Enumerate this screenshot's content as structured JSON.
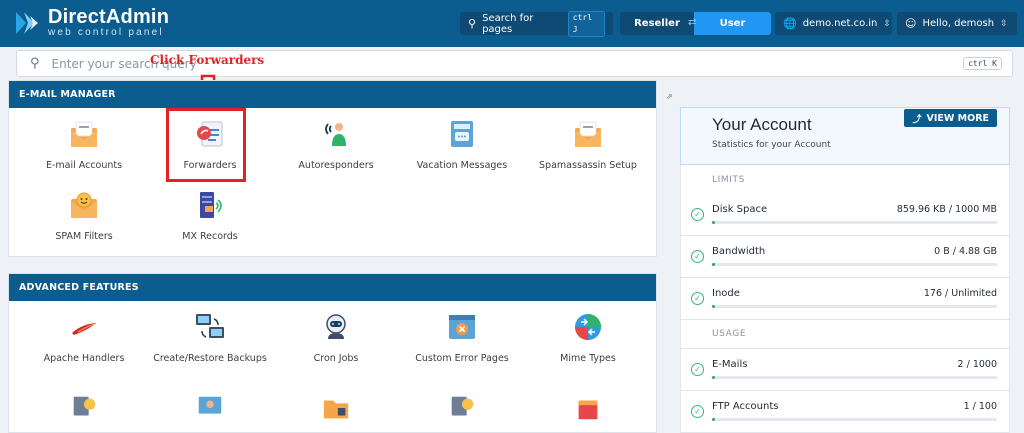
{
  "header": {
    "logo": {
      "title": "DirectAdmin",
      "subtitle": "web control panel"
    },
    "search_button": {
      "label": "Search for pages",
      "shortcut": "ctrl J",
      "icon": "search-icon"
    },
    "roles": {
      "reseller": "Reseller",
      "user": "User",
      "active": "User"
    },
    "domain": {
      "label": "demo.net.co.in",
      "icon": "globe-icon"
    },
    "account": {
      "label": "Hello, demosh",
      "icon": "user-icon"
    }
  },
  "search": {
    "placeholder": "Enter your search query",
    "shortcut": "ctrl K"
  },
  "annotation": {
    "text": "Click Forwarders",
    "color": "#e02424"
  },
  "email_manager": {
    "title": "E-MAIL MANAGER",
    "items": [
      {
        "label": "E-mail Accounts",
        "icon": "envelope-icon"
      },
      {
        "label": "Forwarders",
        "icon": "forwarders-icon"
      },
      {
        "label": "Autoresponders",
        "icon": "autoresponder-icon"
      },
      {
        "label": "Vacation Messages",
        "icon": "vacation-messages-icon"
      },
      {
        "label": "Spamassassin Setup",
        "icon": "spamassassin-icon"
      },
      {
        "label": "SPAM Filters",
        "icon": "spam-filters-icon"
      },
      {
        "label": "MX Records",
        "icon": "mx-records-icon"
      }
    ]
  },
  "advanced": {
    "title": "ADVANCED FEATURES",
    "items": [
      {
        "label": "Apache Handlers",
        "icon": "apache-feather-icon"
      },
      {
        "label": "Create/Restore Backups",
        "icon": "backups-icon"
      },
      {
        "label": "Cron Jobs",
        "icon": "cron-robot-icon"
      },
      {
        "label": "Custom Error Pages",
        "icon": "error-page-icon"
      },
      {
        "label": "Mime Types",
        "icon": "mime-types-icon"
      }
    ]
  },
  "account_panel": {
    "title": "Your Account",
    "subtitle": "Statistics for your Account",
    "view_more": "VIEW MORE",
    "limits_label": "LIMITS",
    "usage_label": "USAGE",
    "limits": [
      {
        "name": "Disk Space",
        "value": "859.96 KB / 1000 MB",
        "fraction": 0.001
      },
      {
        "name": "Bandwidth",
        "value": "0 B / 4.88 GB",
        "fraction": 0
      },
      {
        "name": "Inode",
        "value": "176 / Unlimited",
        "fraction": 0
      }
    ],
    "usage": [
      {
        "name": "E-Mails",
        "value": "2 / 1000",
        "fraction": 0.002
      },
      {
        "name": "FTP Accounts",
        "value": "1 / 100",
        "fraction": 0.01
      }
    ]
  },
  "colors": {
    "brand": "#0b5c8f",
    "accent": "#2196f3",
    "success": "#36b37e"
  }
}
